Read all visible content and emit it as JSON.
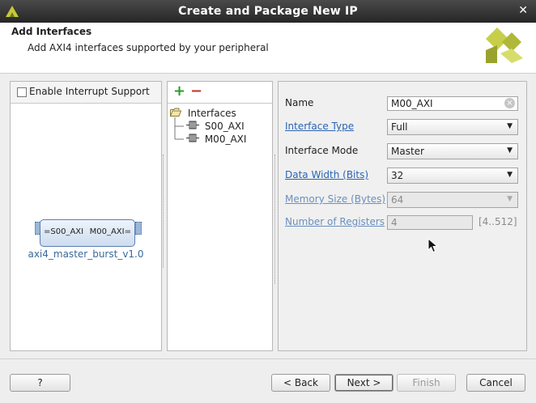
{
  "window": {
    "title": "Create and Package New IP",
    "close_glyph": "✕"
  },
  "header": {
    "title": "Add Interfaces",
    "subtitle": "Add AXI4 interfaces supported by your peripheral"
  },
  "left_panel": {
    "interrupt_label": "Enable Interrupt Support",
    "interrupt_checked": false,
    "block": {
      "slave_port": "S00_AXI",
      "master_port": "M00_AXI",
      "caption": "axi4_master_burst_v1.0"
    }
  },
  "tree": {
    "add_icon": "+",
    "remove_icon": "−",
    "root": "Interfaces",
    "items": [
      "S00_AXI",
      "M00_AXI"
    ]
  },
  "props": {
    "name_label": "Name",
    "name_value": "M00_AXI",
    "interface_type_label": "Interface Type",
    "interface_type_value": "Full",
    "interface_mode_label": "Interface Mode",
    "interface_mode_value": "Master",
    "data_width_label": "Data Width (Bits)",
    "data_width_value": "32",
    "memory_size_label": "Memory Size (Bytes)",
    "memory_size_value": "64",
    "num_regs_label": "Number of Registers",
    "num_regs_value": "4",
    "num_regs_range": "[4..512]"
  },
  "footer": {
    "help": "?",
    "back": "< Back",
    "next": "Next >",
    "finish": "Finish",
    "cancel": "Cancel"
  },
  "colors": {
    "link": "#2a64b4",
    "logo": "#b8c23a",
    "title_bar": "#303030"
  }
}
